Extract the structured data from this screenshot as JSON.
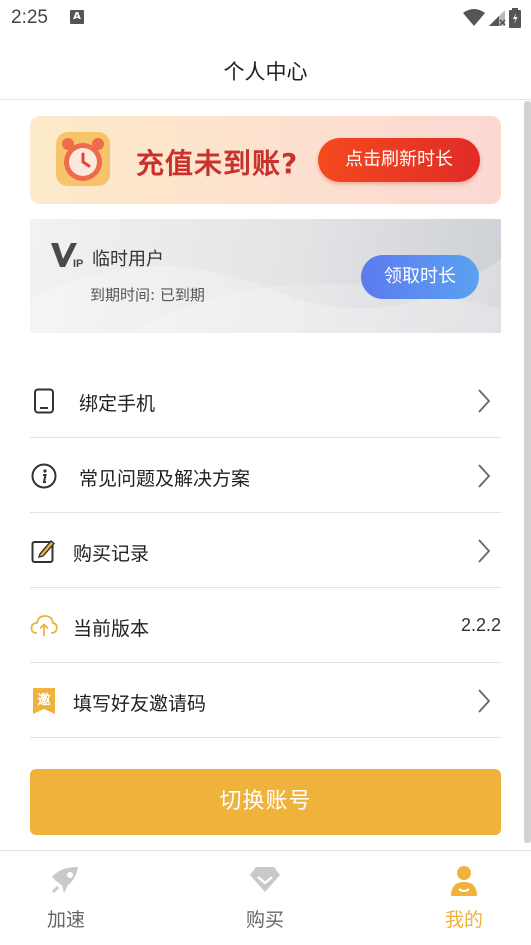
{
  "status_bar": {
    "time": "2:25",
    "notification_glyph": "A"
  },
  "header": {
    "title": "个人中心"
  },
  "banner": {
    "text": "充值未到账?",
    "button_label": "点击刷新时长"
  },
  "vip": {
    "badge": "VIP",
    "level": "临时用户",
    "expiry": "到期时间: 已到期",
    "button_label": "领取时长"
  },
  "menu": [
    {
      "label": "绑定手机",
      "icon": "phone-icon",
      "has_arrow": true
    },
    {
      "label": "常见问题及解决方案",
      "icon": "info-icon",
      "has_arrow": true
    },
    {
      "label": "购买记录",
      "icon": "edit-note-icon",
      "has_arrow": true
    },
    {
      "label": "当前版本",
      "icon": "cloud-upload-icon",
      "value": "2.2.2",
      "has_arrow": false
    },
    {
      "label": "填写好友邀请码",
      "icon": "invite-badge-icon",
      "icon_char": "邀",
      "has_arrow": true
    }
  ],
  "switch_button": {
    "label": "切换账号"
  },
  "tabs": [
    {
      "label": "加速",
      "icon": "rocket-icon",
      "active": false
    },
    {
      "label": "购买",
      "icon": "diamond-icon",
      "active": false
    },
    {
      "label": "我的",
      "icon": "user-icon",
      "active": true
    }
  ],
  "colors": {
    "accent": "#efb23a",
    "banner_red": "#c8322d",
    "vip_blue": "#5c7af0"
  }
}
